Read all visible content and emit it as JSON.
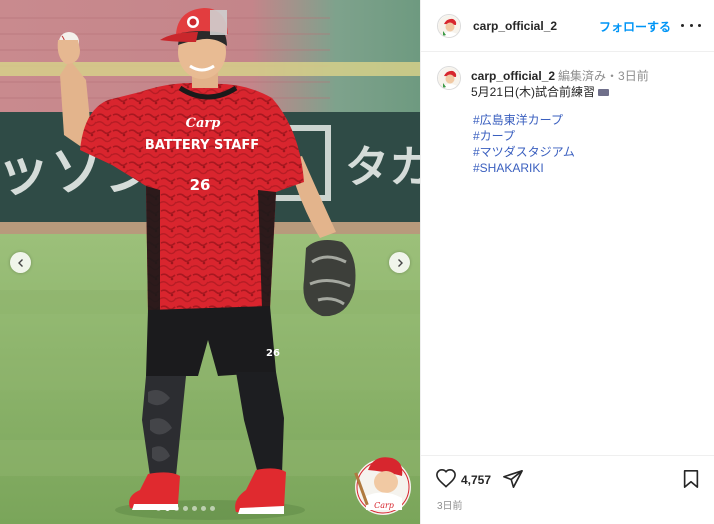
{
  "post": {
    "username": "carp_official_2",
    "follow_label": "フォローする",
    "caption_meta": "編集済み・3日前",
    "caption_text": "5月21日(木)試合前練習",
    "hashtags": [
      "#広島東洋カープ",
      "#カープ",
      "#マツダスタジアム",
      "#SHAKARIKI"
    ],
    "likes": "4,757",
    "timestamp": "3日前"
  },
  "photo": {
    "shirt_text": "BATTERY STAFF",
    "shirt_logo": "Carp",
    "shirt_number": "26",
    "shorts_number": "26",
    "banner_text_left": "ッソン",
    "banner_text_right": "タカ",
    "carousel_dots": 7,
    "active_dot": 1
  },
  "icons": {
    "prev": "chevron-left-icon",
    "next": "chevron-right-icon",
    "more": "more-horizontal-icon",
    "like": "heart-icon",
    "share": "share-icon",
    "save": "bookmark-icon"
  },
  "colors": {
    "accent": "#0095f6",
    "hashtag": "#3a5fbf",
    "jersey": "#d7262e"
  }
}
